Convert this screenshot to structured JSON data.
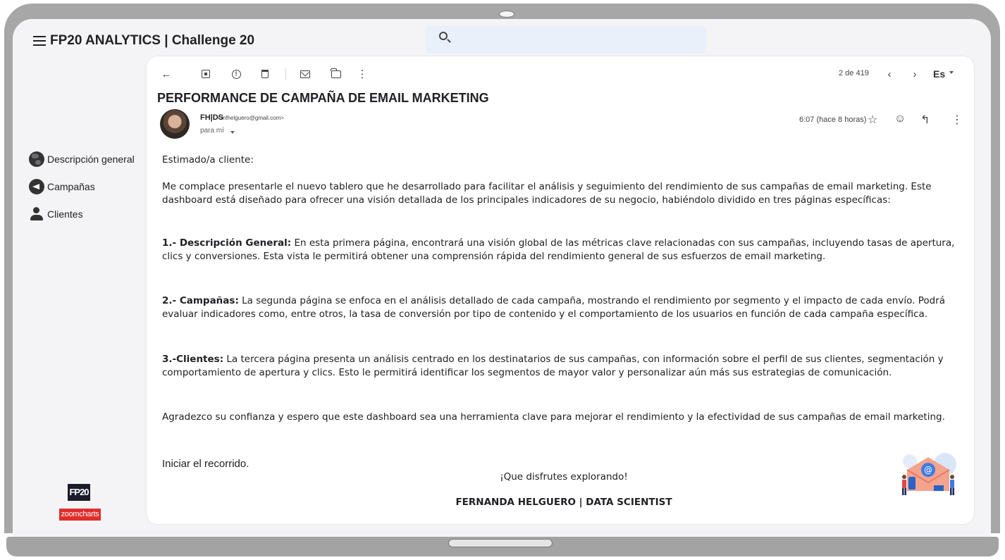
{
  "app": {
    "title": "FP20 ANALYTICS | Challenge 20"
  },
  "sidebar": {
    "items": [
      {
        "label": "Descripción general",
        "icon": "globe-icon"
      },
      {
        "label": "Campañas",
        "icon": "megaphone-icon"
      },
      {
        "label": "Clientes",
        "icon": "people-icon"
      }
    ],
    "logos": {
      "fp20": "FP20",
      "zoomcharts": "zoomcharts"
    }
  },
  "email": {
    "counter": "2 de 419",
    "language": "Es",
    "subject": "PERFORMANCE DE CAMPAÑA DE EMAIL MARKETING",
    "sender_name": "FH|DS",
    "sender_email": "<mfhelguero@gmail.com>",
    "recipient": "para mí",
    "timestamp": "6:07 (hace 8 horas)",
    "greeting": "Estimado/a cliente:",
    "intro": "Me complace presentarle el nuevo tablero que he desarrollado para facilitar el análisis y seguimiento del rendimiento de sus campañas de email marketing. Este dashboard está diseñado para ofrecer una visión detallada de los principales indicadores de su negocio, habiéndolo dividido en tres páginas específicas:",
    "sections": [
      {
        "heading": "1.- Descripción General:",
        "text": " En esta primera página, encontrará una visión global de las métricas clave relacionadas con sus campañas, incluyendo tasas de apertura, clics y conversiones. Esta vista le permitirá obtener una comprensión rápida del rendimiento general de sus esfuerzos de email marketing."
      },
      {
        "heading": "2.- Campañas:",
        "text": " La segunda página se enfoca en el análisis detallado de cada campaña, mostrando el rendimiento por segmento y el impacto de cada envío. Podrá evaluar indicadores como, entre otros, la tasa de conversión por tipo de contenido y el comportamiento de los usuarios en función de cada campaña específica."
      },
      {
        "heading": "3.-Clientes:",
        "text": " La tercera página presenta un análisis centrado en los destinatarios de sus campañas, con información sobre el perfil de sus clientes, segmentación y comportamiento de apertura y clics. Esto le permitirá identificar los segmentos de mayor valor y personalizar aún más sus estrategias de comunicación."
      }
    ],
    "thanks": "Agradezco su confianza y espero que este dashboard sea una herramienta clave para mejorar el rendimiento y la efectividad de sus campañas de email marketing.",
    "start_link": "Iniciar el recorrido.",
    "closing": "¡Que disfrutes explorando!",
    "signature": "FERNANDA HELGUERO | DATA SCIENTIST"
  },
  "colors": {
    "screen_bg": "#f4f4f6",
    "frame": "#a7a7a7",
    "search_bg": "#eaf0fa",
    "zoomcharts_red": "#e22c2c"
  }
}
